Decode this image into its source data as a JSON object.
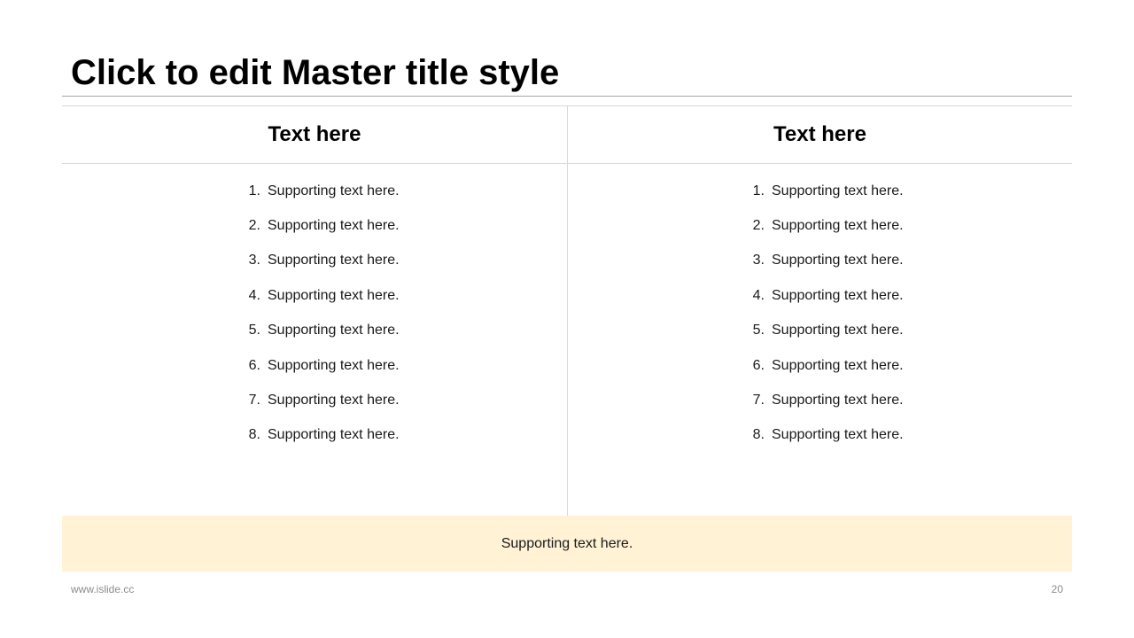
{
  "slide": {
    "title": "Click to edit Master title style",
    "columns": [
      {
        "header": "Text here",
        "items": [
          {
            "num": "1.",
            "text": "Supporting text here."
          },
          {
            "num": "2.",
            "text": "Supporting text here."
          },
          {
            "num": "3.",
            "text": "Supporting text here."
          },
          {
            "num": "4.",
            "text": "Supporting text here."
          },
          {
            "num": "5.",
            "text": "Supporting text here."
          },
          {
            "num": "6.",
            "text": "Supporting text here."
          },
          {
            "num": "7.",
            "text": "Supporting text here."
          },
          {
            "num": "8.",
            "text": "Supporting text here."
          }
        ]
      },
      {
        "header": "Text here",
        "items": [
          {
            "num": "1.",
            "text": "Supporting text here."
          },
          {
            "num": "2.",
            "text": "Supporting text here."
          },
          {
            "num": "3.",
            "text": "Supporting text here."
          },
          {
            "num": "4.",
            "text": "Supporting text here."
          },
          {
            "num": "5.",
            "text": "Supporting text here."
          },
          {
            "num": "6.",
            "text": "Supporting text here."
          },
          {
            "num": "7.",
            "text": "Supporting text here."
          },
          {
            "num": "8.",
            "text": "Supporting text here."
          }
        ]
      }
    ],
    "footer_text": "Supporting text here.",
    "website": "www.islide.cc",
    "page_number": "20"
  },
  "colors": {
    "footer_band": "#fff2d5",
    "rule": "#d9d9d9",
    "title_rule": "#a6a6a6",
    "muted_text": "#8c8c8c"
  }
}
